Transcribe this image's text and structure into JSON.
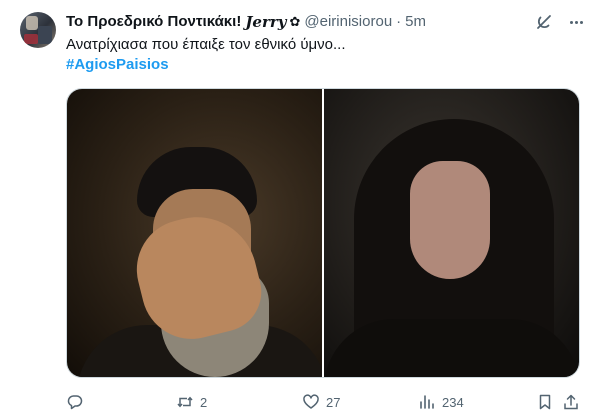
{
  "user": {
    "display_name": "Το Προεδρικό Ποντικάκι!",
    "name_suffix": "𝑱𝒆𝒓𝒓𝒚",
    "name_emoji": "✿",
    "handle": "@eirinisiorou",
    "separator": "·",
    "time": "5m"
  },
  "tweet": {
    "text": "Ανατρίχιασα που έπαιξε τον εθνικό ύμνο...",
    "hashtag": "#AgiosPaisios"
  },
  "colors": {
    "link": "#1d9bf0",
    "text": "#0f1419",
    "muted": "#536471",
    "border": "#cfd9de"
  },
  "actions": {
    "reply_count": "",
    "retweet_count": "2",
    "like_count": "27",
    "views_count": "234"
  },
  "icons": {
    "reply": "speech-bubble-icon",
    "retweet": "retweet-icon",
    "like": "heart-icon",
    "views": "bar-chart-icon",
    "bookmark": "bookmark-icon",
    "share": "share-icon",
    "grok": "grok-icon",
    "more": "more-icon"
  }
}
